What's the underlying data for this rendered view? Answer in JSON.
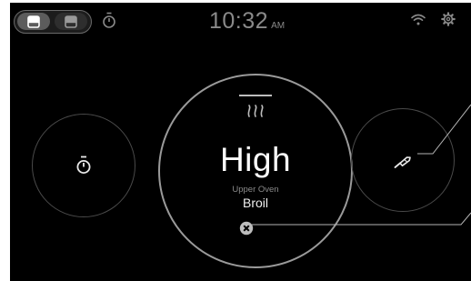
{
  "status_bar": {
    "time": "10:32",
    "ampm": "AM",
    "toggle_segments": [
      "upper-oven-icon",
      "lower-oven-icon"
    ],
    "icons": [
      "timer-icon",
      "wifi-icon",
      "gear-icon"
    ]
  },
  "main_dial": {
    "mode_icon": "heat-waves-icon",
    "level": "High",
    "oven_name": "Upper Oven",
    "mode": "Broil",
    "cancel_icon": "close-icon"
  },
  "left_dial": {
    "icon": "timer-icon"
  },
  "right_dial": {
    "icon": "probe-icon"
  },
  "colors": {
    "background": "#000000",
    "text": "#ffffff",
    "dim_text": "#8a8a8a",
    "ring": "#9a9a9a"
  }
}
